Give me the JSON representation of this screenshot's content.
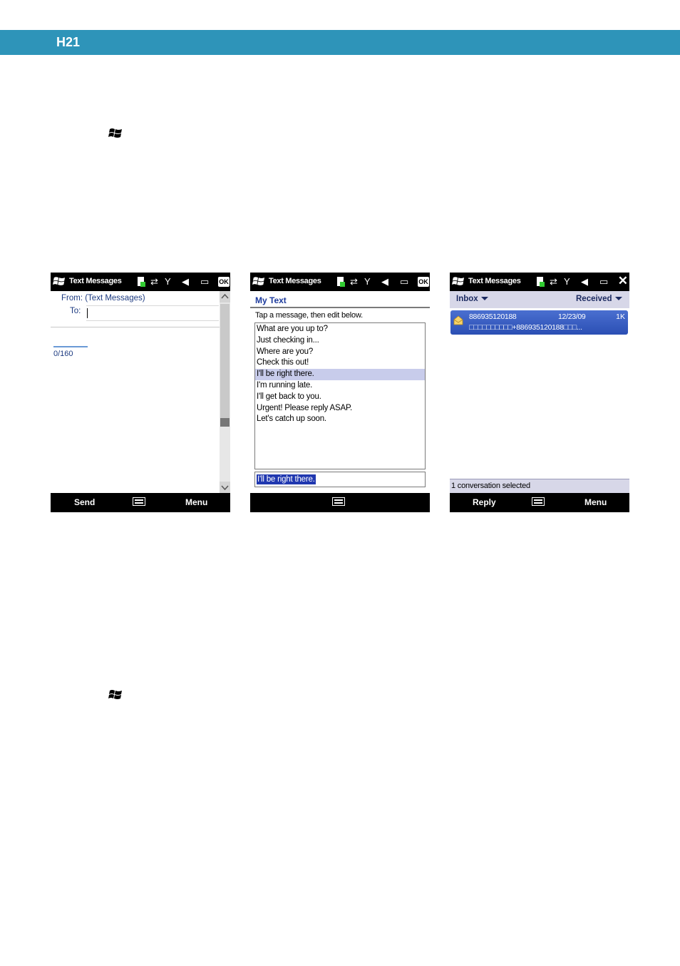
{
  "page": {
    "header_title": "H21",
    "flag_icon": "windows-start-icon"
  },
  "phones": [
    {
      "status_title": "Text Messages",
      "close_label": "OK",
      "from_label": "From: (Text Messages)",
      "to_label": "To:",
      "counter": "0/160",
      "softkeys": {
        "left": "Send",
        "right": "Menu"
      }
    },
    {
      "status_title": "Text Messages",
      "close_label": "OK",
      "title": "My Text",
      "instruction": "Tap a message, then edit below.",
      "messages": [
        "What are you up to?",
        "Just checking in...",
        "Where are you?",
        "Check this out!",
        "I'll be right there.",
        "I'm running late.",
        "I'll get back to you.",
        "Urgent! Please reply ASAP.",
        "Let's catch up soon."
      ],
      "selected_index": 4,
      "edit_value": "I'll be right there."
    },
    {
      "status_title": "Text Messages",
      "close_label": "✕",
      "filter_left": "Inbox",
      "filter_right": "Received",
      "conversation": {
        "number": "886935120188",
        "date": "12/23/09",
        "size": "1K",
        "preview": "□□□□□□□□□□+886935120188□□□..."
      },
      "status_text": "1 conversation selected",
      "softkeys": {
        "left": "Reply",
        "right": "Menu"
      }
    }
  ],
  "colors": {
    "header_bar": "#2e94b9",
    "selection": "#2038b0",
    "conversation_row": "#2b4fb4"
  }
}
